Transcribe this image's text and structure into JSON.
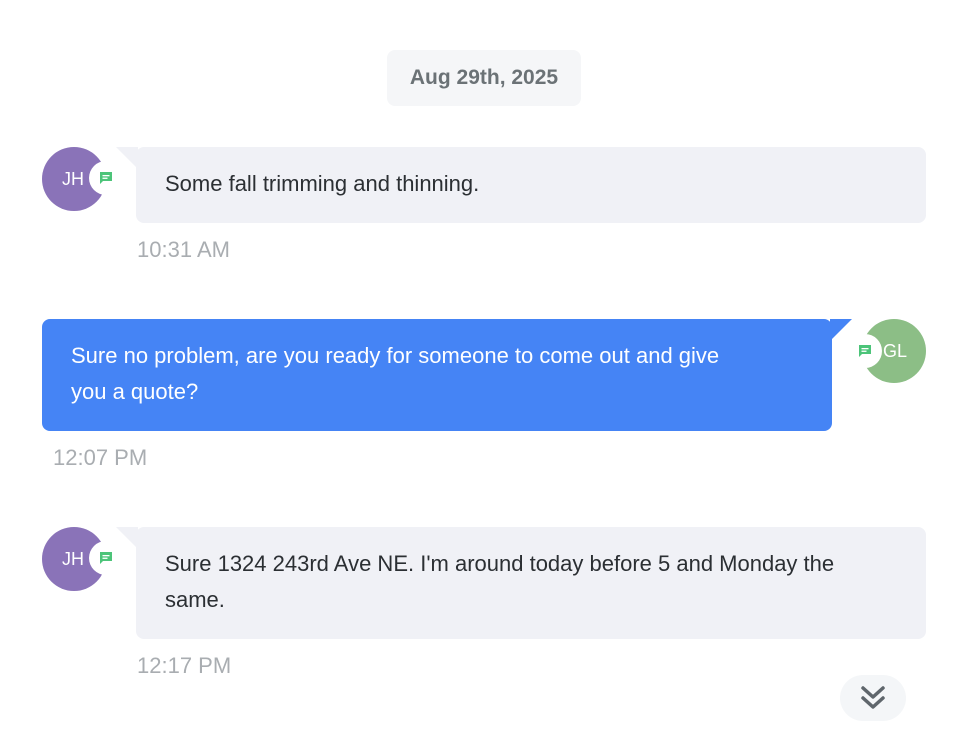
{
  "date_separator": "Aug 29th, 2025",
  "messages": [
    {
      "direction": "incoming",
      "initials": "JH",
      "avatar_color": "#8a73b8",
      "text": "Some fall trimming and thinning.",
      "time": "10:31 AM",
      "channel_icon": "sms-icon"
    },
    {
      "direction": "outgoing",
      "initials": "GL",
      "avatar_color": "#8cbe86",
      "text": "Sure no problem, are you ready for someone to come out and give you a quote?",
      "time": "12:07 PM",
      "channel_icon": "sms-icon"
    },
    {
      "direction": "incoming",
      "initials": "JH",
      "avatar_color": "#8a73b8",
      "text": "Sure 1324 243rd Ave NE. I'm around today before 5 and Monday the same.",
      "time": "12:17 PM",
      "channel_icon": "sms-icon"
    }
  ],
  "colors": {
    "incoming_bubble": "#f0f1f6",
    "outgoing_bubble": "#4584f5",
    "sms_badge_icon": "#4cc479",
    "timestamp": "#a9adb1"
  },
  "scroll_button_icon": "double-chevron-down-icon"
}
